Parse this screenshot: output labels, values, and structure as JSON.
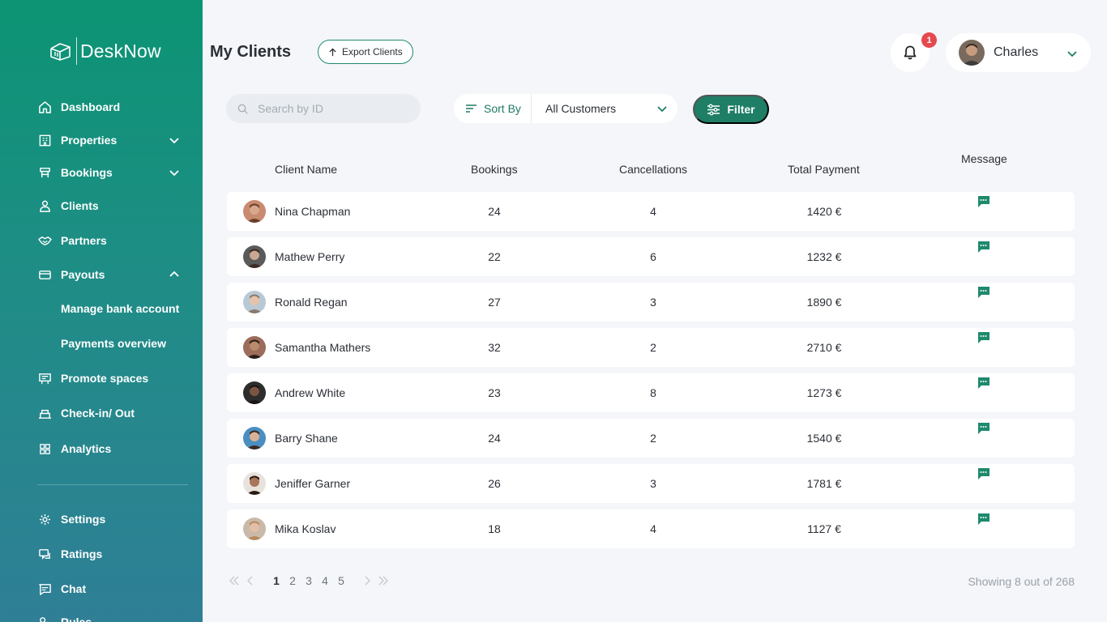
{
  "app": {
    "brand": "DeskNow"
  },
  "sidebar": {
    "items": [
      {
        "label": "Dashboard"
      },
      {
        "label": "Properties"
      },
      {
        "label": "Bookings"
      },
      {
        "label": "Clients"
      },
      {
        "label": "Partners"
      },
      {
        "label": "Payouts"
      },
      {
        "label": "Manage bank account"
      },
      {
        "label": "Payments overview"
      },
      {
        "label": "Promote spaces"
      },
      {
        "label": "Check-in/ Out"
      },
      {
        "label": "Analytics"
      },
      {
        "label": "Settings"
      },
      {
        "label": "Ratings"
      },
      {
        "label": "Chat"
      },
      {
        "label": "Rules"
      }
    ]
  },
  "header": {
    "title": "My Clients",
    "export_label": "Export Clients",
    "notification_count": "1",
    "user_name": "Charles"
  },
  "toolbar": {
    "search_placeholder": "Search by ID",
    "sort_label": "Sort By",
    "customer_filter": "All Customers",
    "filter_label": "Filter"
  },
  "table": {
    "columns": [
      "Client Name",
      "Bookings",
      "Cancellations",
      "Total Payment",
      "Message"
    ],
    "rows": [
      {
        "name": "Nina Chapman",
        "bookings": "24",
        "cancellations": "4",
        "payment": "1420 €"
      },
      {
        "name": "Mathew Perry",
        "bookings": "22",
        "cancellations": "6",
        "payment": "1232 €"
      },
      {
        "name": "Ronald Regan",
        "bookings": "27",
        "cancellations": "3",
        "payment": "1890 €"
      },
      {
        "name": "Samantha Mathers",
        "bookings": "32",
        "cancellations": "2",
        "payment": "2710 €"
      },
      {
        "name": "Andrew White",
        "bookings": "23",
        "cancellations": "8",
        "payment": "1273 €"
      },
      {
        "name": "Barry Shane",
        "bookings": "24",
        "cancellations": "2",
        "payment": "1540 €"
      },
      {
        "name": "Jeniffer Garner",
        "bookings": "26",
        "cancellations": "3",
        "payment": "1781 €"
      },
      {
        "name": "Mika Koslav",
        "bookings": "18",
        "cancellations": "4",
        "payment": "1127 €"
      }
    ]
  },
  "pagination": {
    "pages": [
      "1",
      "2",
      "3",
      "4",
      "5"
    ],
    "current": "1",
    "showing": "Showing 8 out of 268"
  },
  "colors": {
    "accent": "#1e7e66",
    "sidebar_top": "#0c9474",
    "sidebar_bottom": "#2f7f96",
    "badge": "#e5484d",
    "message_icon": "#1e8a6c"
  },
  "icons": {
    "sidebar": [
      "home-icon",
      "building-icon",
      "bookings-icon",
      "client-icon",
      "handshake-icon",
      "card-icon",
      "promote-icon",
      "checkin-icon",
      "grid-icon",
      "gear-icon",
      "ratings-icon",
      "chat-icon",
      "rules-icon"
    ],
    "message": "message-icon"
  }
}
